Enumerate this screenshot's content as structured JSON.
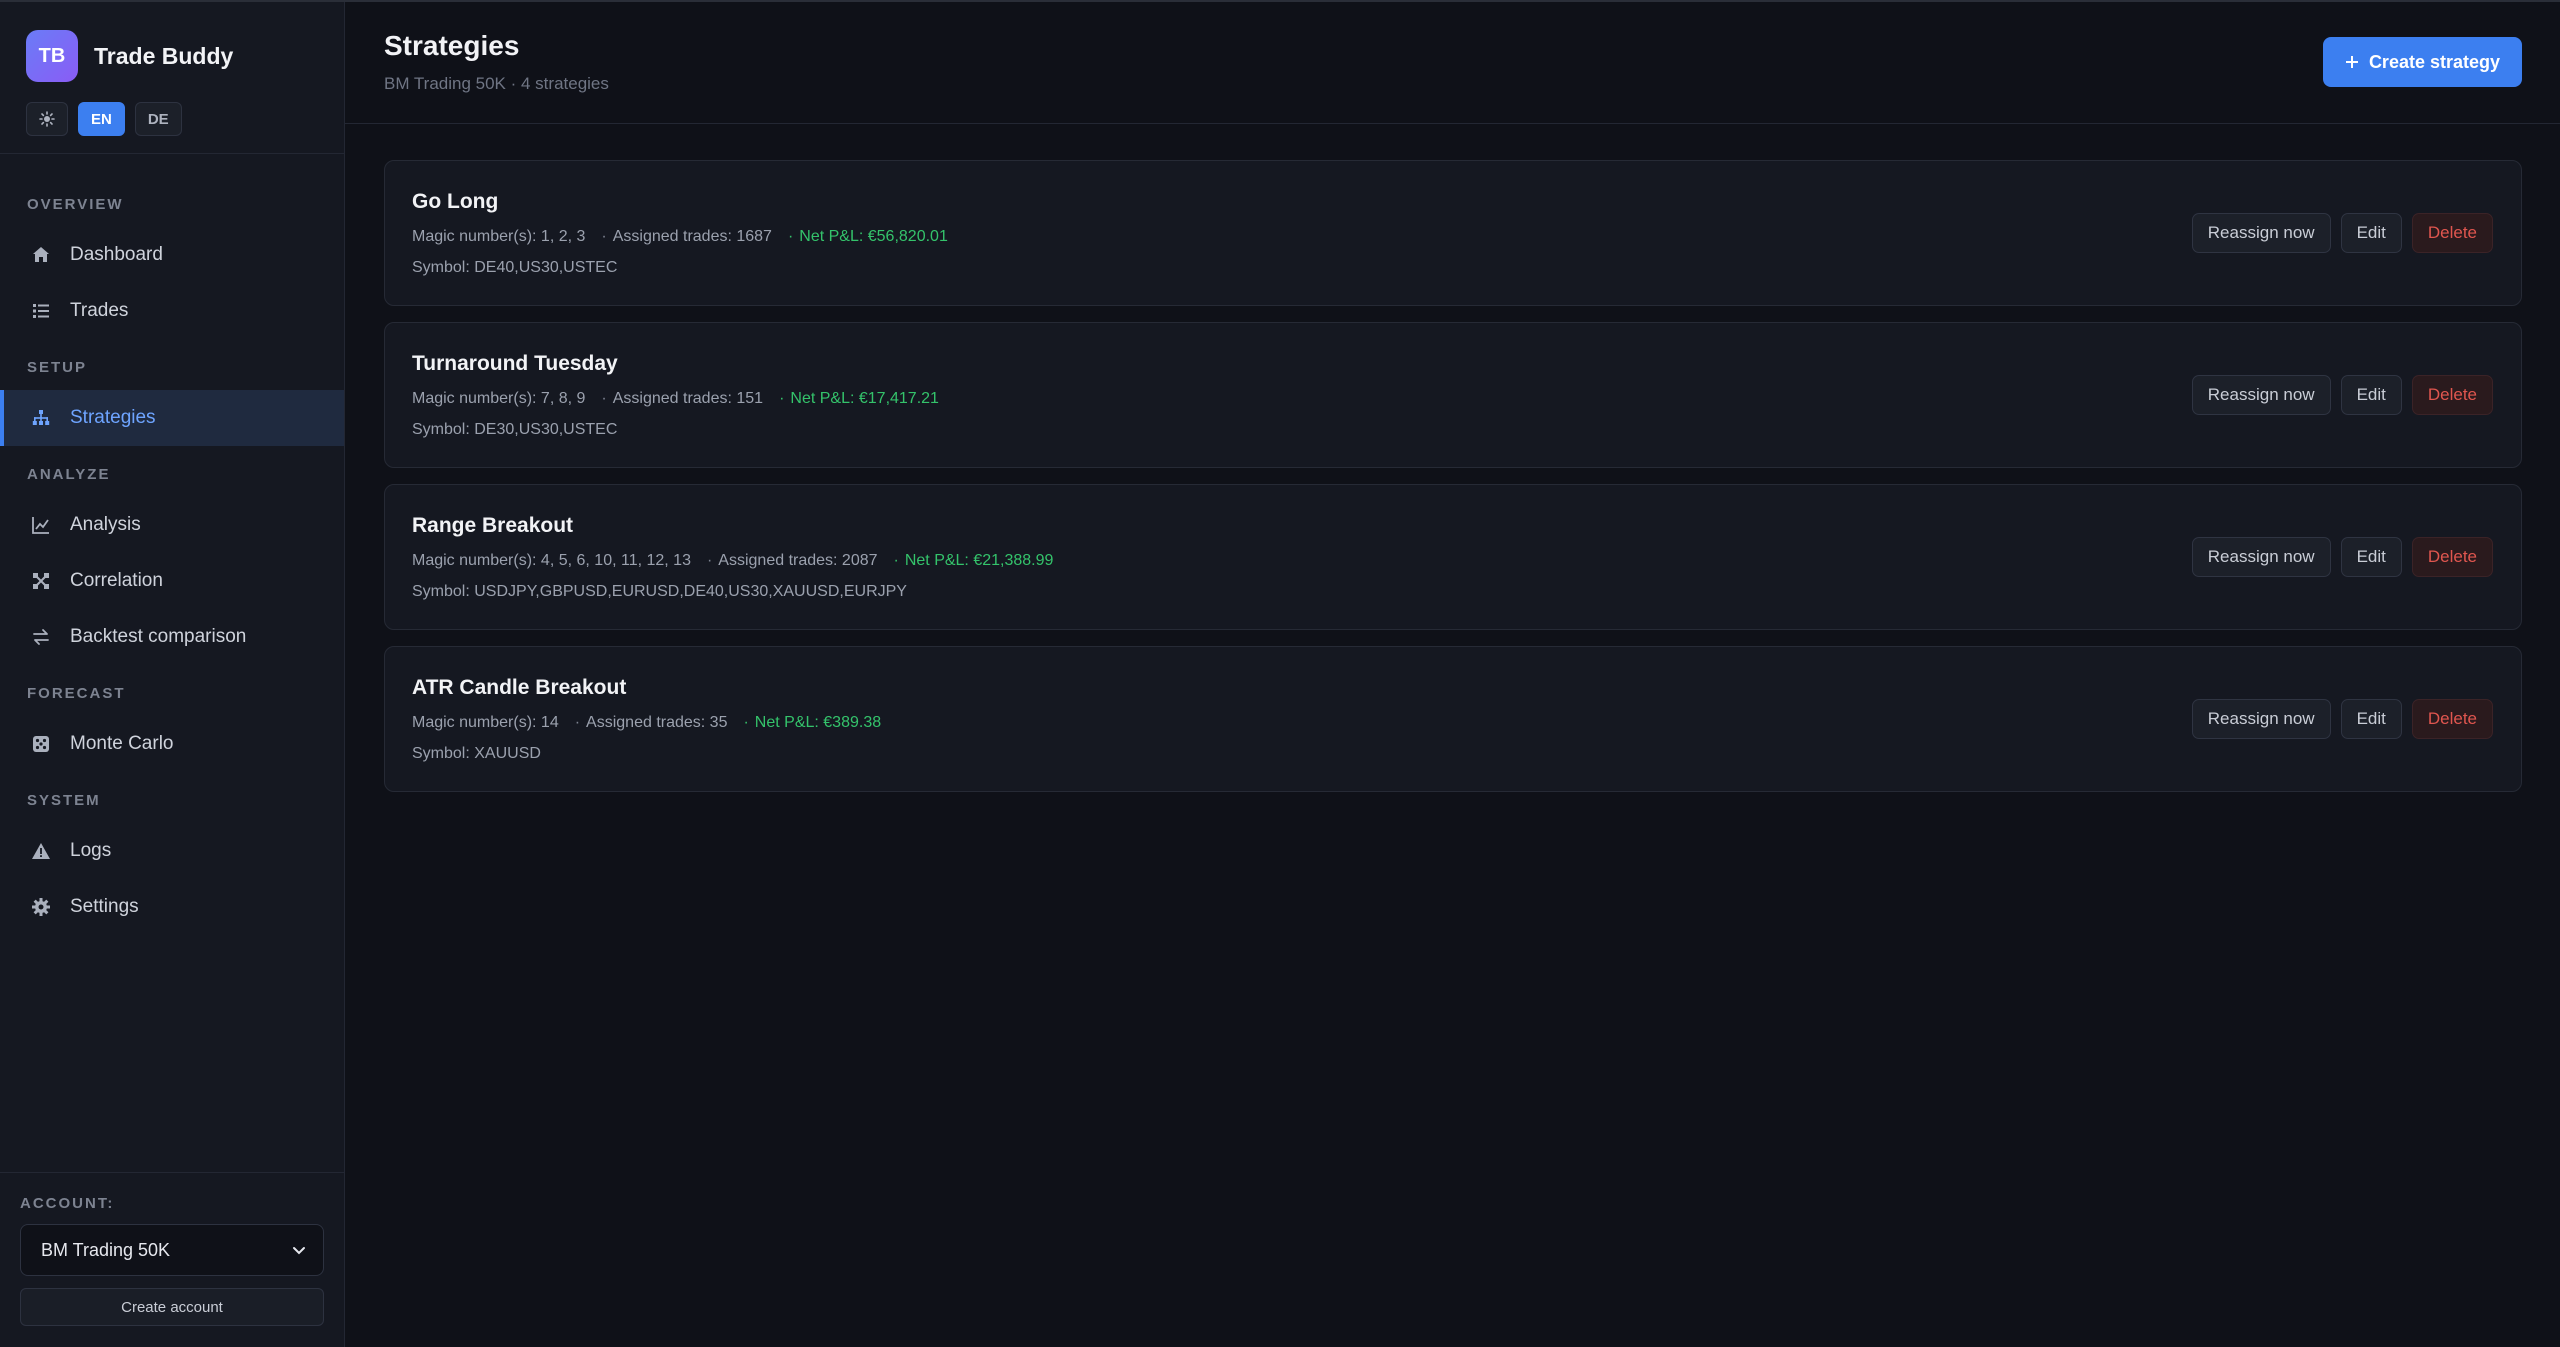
{
  "brand": {
    "logo": "TB",
    "name": "Trade Buddy"
  },
  "lang": {
    "theme_icon": "sun-icon",
    "en": "EN",
    "de": "DE"
  },
  "nav": {
    "overview": {
      "title": "OVERVIEW",
      "dashboard": "Dashboard",
      "trades": "Trades"
    },
    "setup": {
      "title": "SETUP",
      "strategies": "Strategies"
    },
    "analyze": {
      "title": "ANALYZE",
      "analysis": "Analysis",
      "correlation": "Correlation",
      "backtest": "Backtest comparison"
    },
    "forecast": {
      "title": "FORECAST",
      "montecarlo": "Monte Carlo"
    },
    "system": {
      "title": "SYSTEM",
      "logs": "Logs",
      "settings": "Settings"
    }
  },
  "account": {
    "label": "ACCOUNT:",
    "selected": "BM Trading 50K",
    "create": "Create account"
  },
  "header": {
    "title": "Strategies",
    "subtitle": "BM Trading 50K · 4 strategies",
    "create_button": "Create strategy"
  },
  "colors": {
    "accent": "#3c7ff0",
    "pnl_positive": "#34c36b",
    "danger": "#e0564f"
  },
  "strategies": [
    {
      "name": "Go Long",
      "magic": "Magic number(s): 1, 2, 3",
      "trades": "Assigned trades: 1687",
      "pnl": "Net P&L: €56,820.01",
      "symbol": "Symbol: DE40,US30,USTEC"
    },
    {
      "name": "Turnaround Tuesday",
      "magic": "Magic number(s): 7, 8, 9",
      "trades": "Assigned trades: 151",
      "pnl": "Net P&L: €17,417.21",
      "symbol": "Symbol: DE30,US30,USTEC"
    },
    {
      "name": "Range Breakout",
      "magic": "Magic number(s): 4, 5, 6, 10, 11, 12, 13",
      "trades": "Assigned trades: 2087",
      "pnl": "Net P&L: €21,388.99",
      "symbol": "Symbol: USDJPY,GBPUSD,EURUSD,DE40,US30,XAUUSD,EURJPY"
    },
    {
      "name": "ATR Candle Breakout",
      "magic": "Magic number(s): 14",
      "trades": "Assigned trades: 35",
      "pnl": "Net P&L: €389.38",
      "symbol": "Symbol: XAUUSD"
    }
  ],
  "card_actions": {
    "reassign": "Reassign now",
    "edit": "Edit",
    "delete": "Delete"
  }
}
